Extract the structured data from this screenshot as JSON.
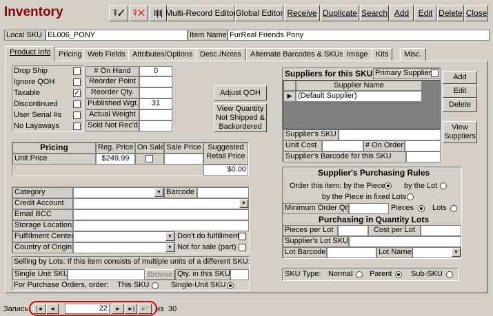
{
  "app": {
    "title": "Inventory"
  },
  "toolbar": {
    "multi": "Multi-Record Editor",
    "global": "Global Editor",
    "receive": "Receive",
    "duplicate": "Duplicate",
    "search": "Search",
    "add": "Add",
    "edit": "Edit",
    "delete": "Delete",
    "close": "Close",
    "icon1": "funnel-check-icon",
    "icon2": "funnel-x-icon",
    "icon3": "barcode-icon"
  },
  "header": {
    "local_sku_label": "Local SKU",
    "local_sku_value": "EL006_PONY",
    "item_name_label": "Item Name",
    "item_name_value": "FurReal Friends Pony"
  },
  "tabs": [
    "Product Info",
    "Pricing",
    "Web Fields",
    "Attributes/Options",
    "Desc./Notes",
    "Alternate Barcodes & SKUs",
    "Image",
    "Kits",
    "Misc."
  ],
  "flags": [
    {
      "label": "Drop Ship",
      "checked": false
    },
    {
      "label": "Ignore QOH",
      "checked": false
    },
    {
      "label": "Taxable",
      "checked": true
    },
    {
      "label": "Discontinued",
      "checked": false
    },
    {
      "label": "User Serial #s",
      "checked": false
    },
    {
      "label": "No Layaways",
      "checked": false
    }
  ],
  "stock": [
    {
      "label": "# On Hand",
      "value": "0"
    },
    {
      "label": "Reorder Point",
      "value": ""
    },
    {
      "label": "Reorder Qty.",
      "value": ""
    },
    {
      "label": "Published Wgt.",
      "value": "31"
    },
    {
      "label": "Actual Weight",
      "value": ""
    },
    {
      "label": "Sold Not Rec'd",
      "value": ""
    }
  ],
  "buttons": {
    "adjust": "Adjust QOH",
    "view_qty": "View Quantity Not Shipped & Backordered"
  },
  "pricing": {
    "h_pricing": "Pricing",
    "h_reg": "Reg. Price",
    "h_onsale": "On Sale",
    "h_sale": "Sale Price",
    "h_suggested": "Suggested Retail Price",
    "unit_label": "Unit Price",
    "reg": "$249.99",
    "sale": "",
    "suggested": "$0.00"
  },
  "details": {
    "category": "Category",
    "barcode": "Barcode",
    "credit": "Credit Account",
    "email": "Email BCC",
    "storage": "Storage Location",
    "fulfillment": "Fulfillment Center",
    "dont_fulfill": "Don't do fulfillment",
    "origin": "Country of Origin",
    "not_sale": "Not for sale (part)"
  },
  "lots": {
    "text": "Selling by Lots: If this item consists of multiple units of a different SKU:",
    "single": "Single Unit SKU",
    "browse": "Browse",
    "qty": "Qty. in this SKU",
    "po": "For Purchase Orders, order:",
    "this_sku": "This SKU",
    "single_sku": "Single-Unit SKU"
  },
  "suppliers": {
    "title": "Suppliers for this SKU",
    "primary": "Primary Supplier",
    "col": "Supplier Name",
    "row": "(Default Supplier)",
    "sku": "Supplier's SKU",
    "unit_cost": "Unit Cost",
    "on_order": "# On Order",
    "barcode": "Supplier's Barcode for this SKU",
    "add": "Add",
    "edit": "Edit",
    "delete": "Delete",
    "view": "View Suppliers"
  },
  "rules": {
    "title": "Supplier's Purchasing Rules",
    "order": "Order this item: by the Piece",
    "lot": "by the Lot",
    "fixed": "by the Piece in fixed Lots",
    "min": "Minimum Order Qty.",
    "pieces": "Pieces",
    "lots": "Lots",
    "qty_title": "Purchasing in Quantity Lots",
    "per_lot": "Pieces per Lot",
    "cost_lot": "Cost per Lot",
    "lot_sku": "Supplier's Lot SKU",
    "lot_barcode": "Lot Barcode",
    "lot_name": "Lot Name"
  },
  "skutype": {
    "label": "SKU Type:",
    "normal": "Normal",
    "parent": "Parent",
    "sub": "Sub-SKU"
  },
  "nav": {
    "record": "Запись:",
    "current": "22",
    "of": "из",
    "total": "30",
    "first": "|◄",
    "prev": "◄",
    "next": "►",
    "last": "►|",
    "new": "►*"
  }
}
